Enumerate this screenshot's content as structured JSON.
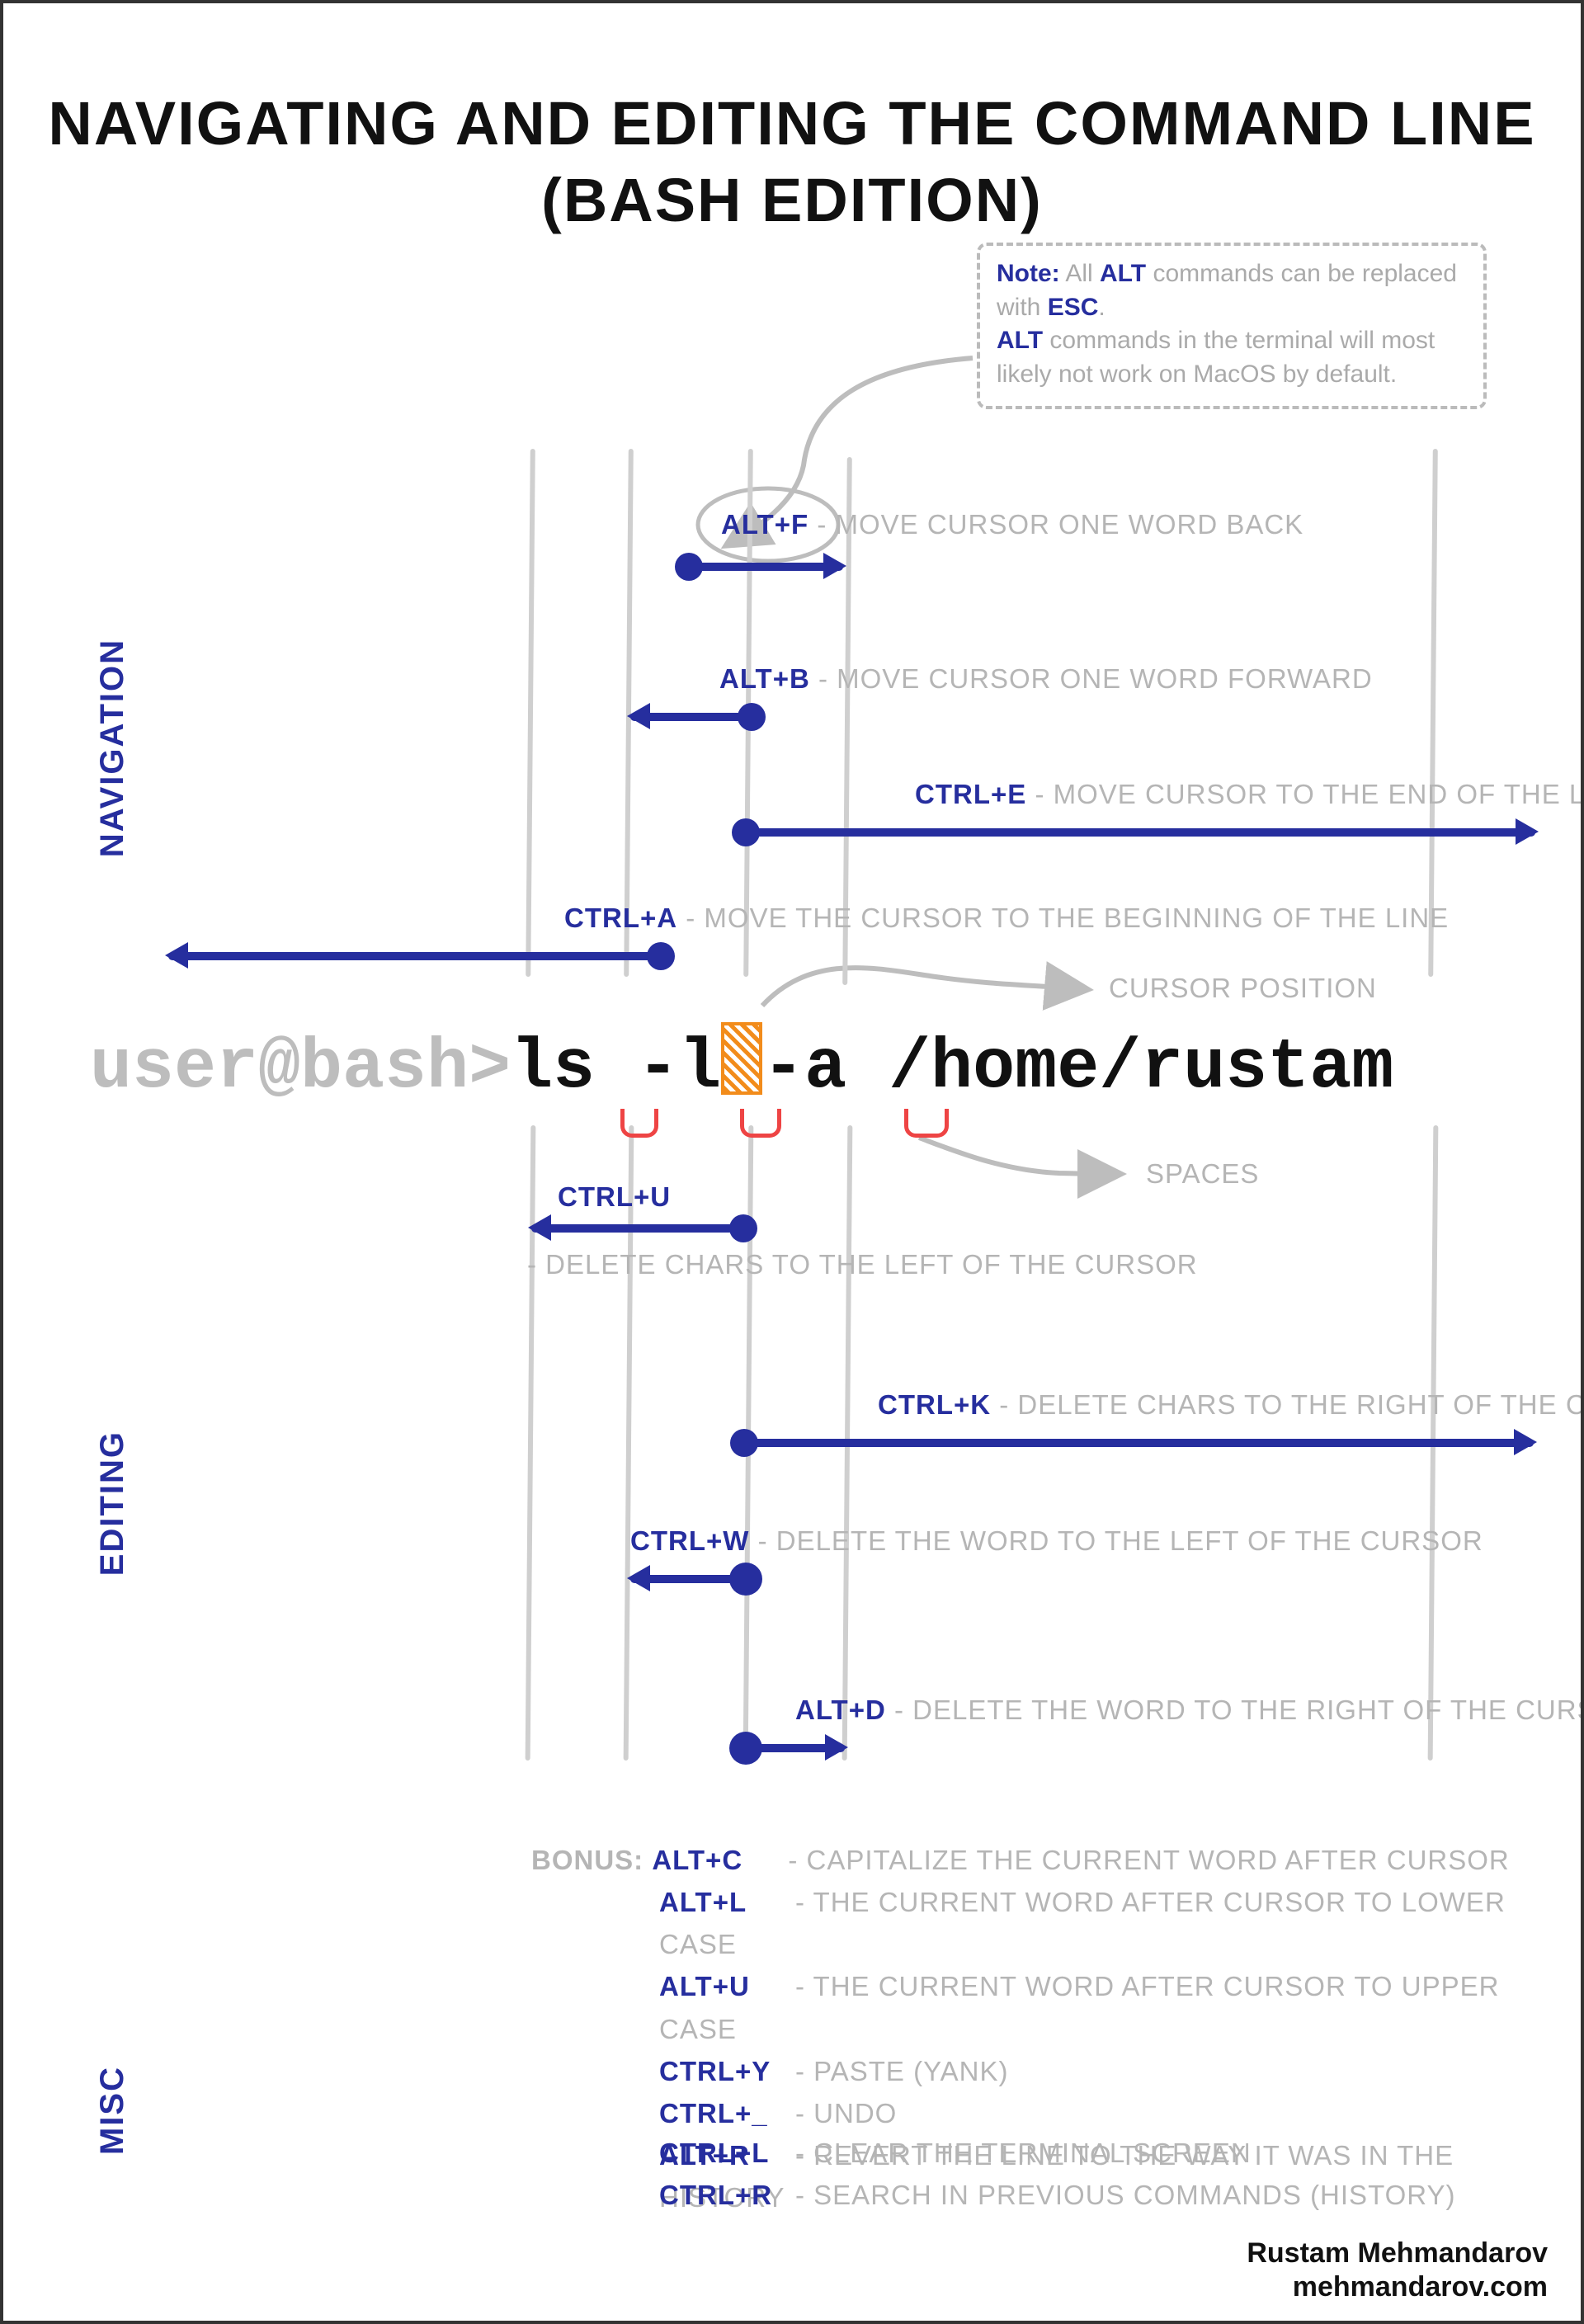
{
  "title_line1": "NAVIGATING AND EDITING THE COMMAND LINE",
  "title_line2": "(BASH EDITION)",
  "note": {
    "label": "Note:",
    "text1_a": " All ",
    "kw1": "ALT",
    "text1_b": " commands can be replaced with ",
    "kw2": "ESC",
    "text1_c": ".",
    "text2_a": "",
    "kw3": "ALT",
    "text2_b": " commands in the terminal will most likely not work on MacOS by default."
  },
  "categories": {
    "navigation": "NAVIGATION",
    "editing": "EDITING",
    "misc": "MISC"
  },
  "command": {
    "prompt": "user@bash>",
    "part1": "ls -l",
    "part2": "-a /home/rustam"
  },
  "annotations": {
    "cursor": "CURSOR POSITION",
    "spaces": "SPACES"
  },
  "shortcuts": {
    "alt_f": {
      "key": "ALT+F",
      "desc": " - MOVE CURSOR ONE WORD BACK"
    },
    "alt_b": {
      "key": "ALT+B",
      "desc": " - MOVE CURSOR ONE WORD FORWARD"
    },
    "ctrl_e": {
      "key": "CTRL+E",
      "desc": " - MOVE CURSOR TO THE END OF THE LINE"
    },
    "ctrl_a": {
      "key": "CTRL+A",
      "desc": " - MOVE THE CURSOR TO THE BEGINNING OF THE LINE"
    },
    "ctrl_u": {
      "key": "CTRL+U",
      "desc": " - DELETE CHARS TO THE LEFT OF THE CURSOR"
    },
    "ctrl_k": {
      "key": "CTRL+K",
      "desc": "- DELETE CHARS TO THE RIGHT OF THE CURSOR"
    },
    "ctrl_w": {
      "key": "CTRL+W",
      "desc": " - DELETE THE WORD TO THE LEFT OF THE CURSOR"
    },
    "alt_d": {
      "key": "ALT+D",
      "desc": " - DELETE THE WORD TO THE RIGHT OF THE CURSOR"
    }
  },
  "bonus": {
    "label": "BONUS:  ",
    "items": [
      {
        "key": "ALT+C",
        "desc": "- CAPITALIZE THE CURRENT WORD AFTER CURSOR"
      },
      {
        "key": "ALT+L",
        "desc": "- THE CURRENT WORD AFTER CURSOR TO LOWER CASE"
      },
      {
        "key": "ALT+U",
        "desc": "- THE CURRENT WORD AFTER CURSOR TO UPPER CASE"
      },
      {
        "key": "CTRL+Y",
        "desc": "- PASTE (YANK)"
      },
      {
        "key": "CTRL+_",
        "desc": "- UNDO"
      },
      {
        "key": "ALT+R",
        "desc": "- REVERT THE LINE TO THE WAY IT WAS IN THE HISTORY"
      }
    ]
  },
  "misc": {
    "items": [
      {
        "key": "CTRL+L",
        "desc": "- CLEAR THE TERMINAL SCREEN"
      },
      {
        "key": "CTRL+R",
        "desc": "- SEARCH IN PREVIOUS COMMANDS (HISTORY)"
      }
    ]
  },
  "credits": {
    "name": "Rustam Mehmandarov",
    "site": "mehmandarov.com"
  }
}
